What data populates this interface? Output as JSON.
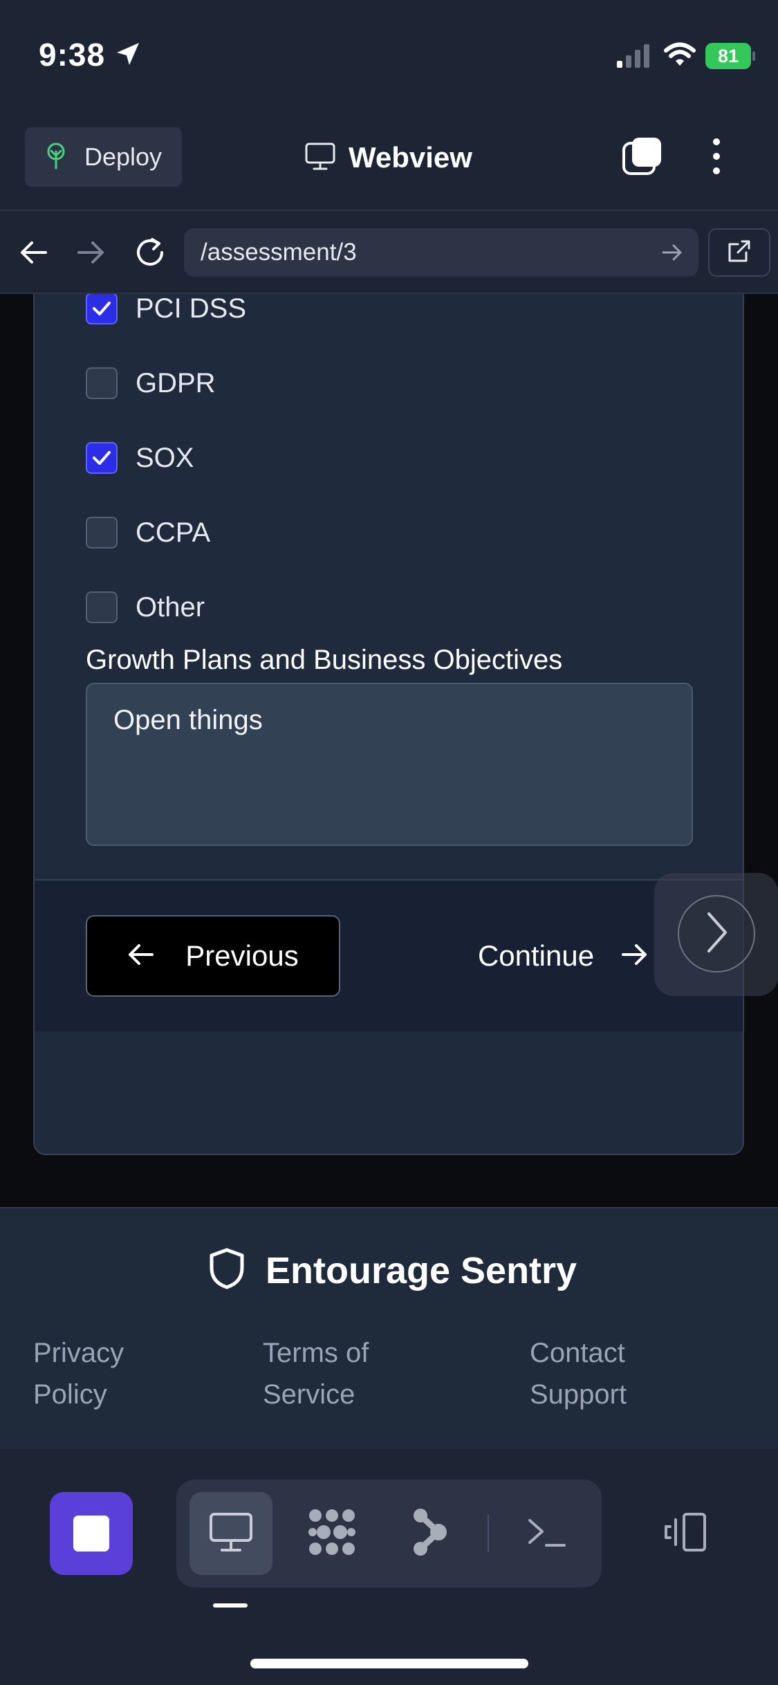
{
  "status_bar": {
    "time": "9:38",
    "battery": "81"
  },
  "header": {
    "deploy_label": "Deploy",
    "title": "Webview"
  },
  "browser": {
    "url": "/assessment/3"
  },
  "form": {
    "compliance_options": [
      {
        "label": "PCI DSS",
        "checked": true
      },
      {
        "label": "GDPR",
        "checked": false
      },
      {
        "label": "SOX",
        "checked": true
      },
      {
        "label": "CCPA",
        "checked": false
      },
      {
        "label": "Other",
        "checked": false
      }
    ],
    "growth_label": "Growth Plans and Business Objectives",
    "growth_value": "Open things",
    "previous_label": "Previous",
    "continue_label": "Continue"
  },
  "footer": {
    "brand": "Entourage Sentry",
    "privacy_line1": "Privacy",
    "privacy_line2": "Policy",
    "terms_line1": "Terms of",
    "terms_line2": "Service",
    "contact_line1": "Contact",
    "contact_line2": "Support"
  },
  "colors": {
    "accent": "#5b3fd9",
    "checkbox_checked": "#2b2ee6",
    "battery": "#34c759"
  },
  "icons": [
    "location-arrow-icon",
    "signal-icon",
    "wifi-icon",
    "sprout-icon",
    "monitor-icon",
    "tabs-icon",
    "more-vertical-icon",
    "back-arrow-icon",
    "forward-arrow-icon",
    "reload-icon",
    "go-arrow-icon",
    "external-link-icon",
    "chevron-right-icon",
    "shield-icon",
    "stop-icon",
    "grid-dots-icon",
    "flow-icon",
    "terminal-icon",
    "side-panel-icon"
  ]
}
